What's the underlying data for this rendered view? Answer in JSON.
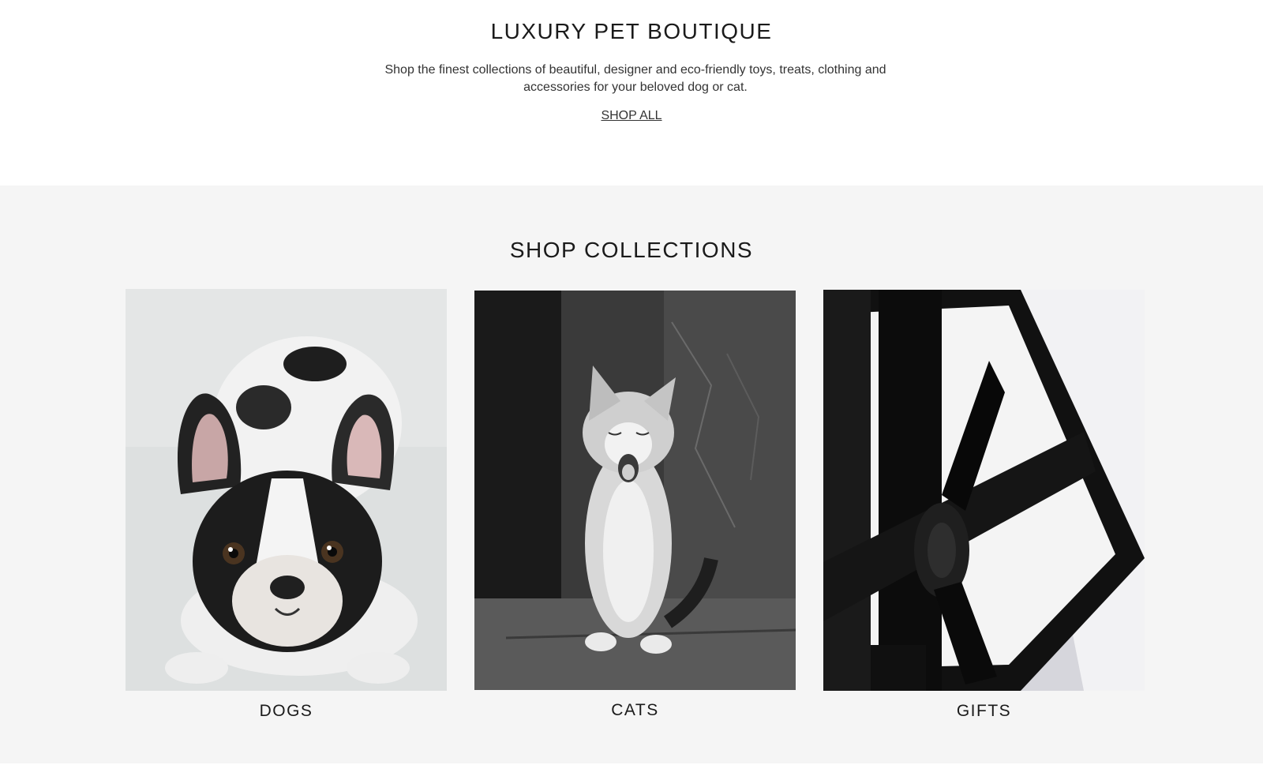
{
  "hero": {
    "title": "LUXURY PET BOUTIQUE",
    "description": "Shop the finest collections of beautiful, designer and eco-friendly toys, treats, clothing and accessories for your beloved dog or cat.",
    "link_label": "SHOP ALL"
  },
  "collections": {
    "title": "SHOP COLLECTIONS",
    "items": [
      {
        "label": "DOGS",
        "image": "french-bulldog-photo"
      },
      {
        "label": "CATS",
        "image": "yawning-kitten-photo"
      },
      {
        "label": "GIFTS",
        "image": "gift-box-ribbon-photo"
      }
    ]
  },
  "colors": {
    "page_bg": "#ffffff",
    "collections_bg": "#f5f5f5",
    "text": "#1a1a1a"
  }
}
